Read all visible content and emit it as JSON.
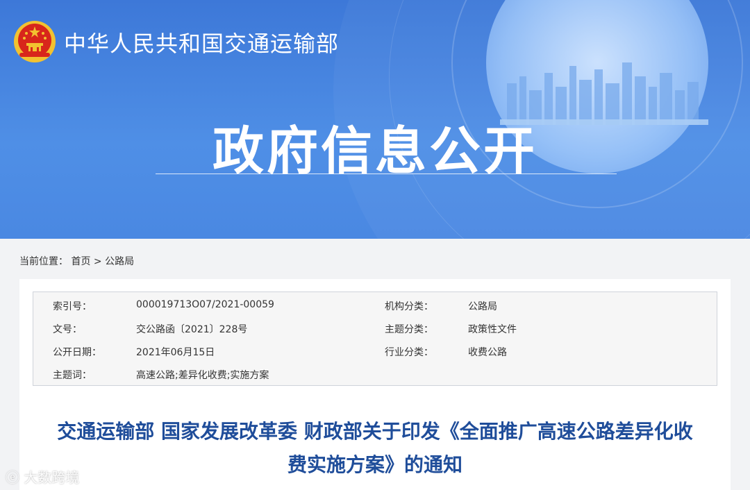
{
  "header": {
    "ministry_name": "中华人民共和国交通运输部",
    "section_title": "政府信息公开"
  },
  "breadcrumb": {
    "prefix": "当前位置：",
    "home": "首页",
    "separator": ">",
    "current": "公路局"
  },
  "meta": {
    "rows": [
      {
        "label1": "索引号：",
        "value1": "000019713O07/2021-00059",
        "label2": "机构分类：",
        "value2": "公路局"
      },
      {
        "label1": "文号：",
        "value1": "交公路函〔2021〕228号",
        "label2": "主题分类：",
        "value2": "政策性文件"
      },
      {
        "label1": "公开日期：",
        "value1": "2021年06月15日",
        "label2": "行业分类：",
        "value2": "收费公路"
      },
      {
        "label1": "主题词：",
        "value1": "高速公路;差异化收费;实施方案",
        "label2": "",
        "value2": ""
      }
    ]
  },
  "document": {
    "title_line1": "交通运输部 国家发展改革委 财政部关于印发《全面推广高速公路差异化收",
    "title_line2": "费实施方案》的通知"
  },
  "watermark": {
    "text": "大数跨境"
  },
  "colors": {
    "banner": "#4a88e2",
    "title": "#1f4d9a",
    "emblem_red": "#d8261b",
    "emblem_gold": "#f2c230"
  }
}
